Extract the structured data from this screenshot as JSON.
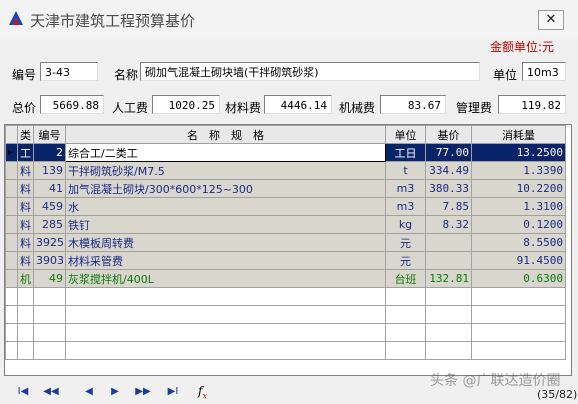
{
  "window": {
    "title": "天津市建筑工程预算基价",
    "close_label": "✕",
    "money_unit": "金额单位:元"
  },
  "item": {
    "code_label": "编号",
    "code": "3-43",
    "name_label": "名称",
    "name": "砌加气混凝土砌块墙(干拌砌筑砂浆)",
    "unit_label": "单位",
    "unit": "10m3"
  },
  "totals": {
    "total_label": "总价",
    "total": "5669.88",
    "labor_label": "人工费",
    "labor": "1020.25",
    "material_label": "材料费",
    "material": "4446.14",
    "machine_label": "机械费",
    "machine": "83.67",
    "mgmt_label": "管理费",
    "mgmt": "119.82"
  },
  "table": {
    "headers": {
      "type": "类",
      "code": "编号",
      "name": "名　称　规　格",
      "unit": "单位",
      "price": "基价",
      "qty": "消耗量"
    },
    "rows": [
      {
        "type": "工",
        "code": "2",
        "name": "综合工/二类工",
        "unit": "工日",
        "price": "77.00",
        "qty": "13.2500"
      },
      {
        "type": "料",
        "code": "139",
        "name": "干拌砌筑砂浆/M7.5",
        "unit": "t",
        "price": "334.49",
        "qty": "1.3390"
      },
      {
        "type": "料",
        "code": "41",
        "name": "加气混凝土砌块/300*600*125~300",
        "unit": "m3",
        "price": "380.33",
        "qty": "10.2200"
      },
      {
        "type": "料",
        "code": "459",
        "name": "水",
        "unit": "m3",
        "price": "7.85",
        "qty": "1.3100"
      },
      {
        "type": "料",
        "code": "285",
        "name": "铁钉",
        "unit": "kg",
        "price": "8.32",
        "qty": "0.1200"
      },
      {
        "type": "料",
        "code": "3925",
        "name": "木模板周转费",
        "unit": "元",
        "price": "",
        "qty": "8.5500"
      },
      {
        "type": "料",
        "code": "3903",
        "name": "材料采管费",
        "unit": "元",
        "price": "",
        "qty": "91.4500"
      },
      {
        "type": "机",
        "code": "49",
        "name": "灰浆搅拌机/400L",
        "unit": "台班",
        "price": "132.81",
        "qty": "0.6300"
      }
    ]
  },
  "nav": {
    "first": "I◀",
    "prev_page": "◀◀",
    "prev": "◀",
    "next": "▶",
    "next_page": "▶▶",
    "last": "▶I",
    "fx": "f",
    "fx_sub": "x",
    "counter": "(35/82)"
  },
  "watermark": "头条 @广联达造价圈",
  "colors": {
    "selection": "#0a246a",
    "data_row": "#d9d6ce",
    "data_text": "#1a2a8a",
    "machine_text": "#0a7a0a",
    "accent_red": "#c00000"
  }
}
